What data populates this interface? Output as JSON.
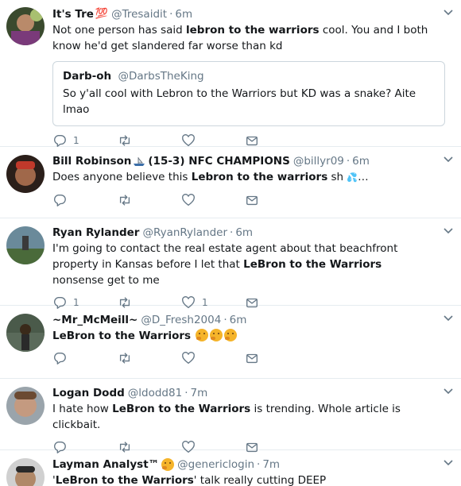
{
  "colors": {
    "accent": "#1da1f2",
    "muted": "#657786",
    "border": "#e6ecf0",
    "emoji": "#f5b42a"
  },
  "icons": {
    "reply": "reply-icon",
    "retweet": "retweet-icon",
    "like": "heart-icon",
    "dm": "envelope-icon",
    "menu": "chevron-down-icon"
  },
  "tweets": [
    {
      "name": "It's Tre",
      "badge": "💯",
      "handle": "@Tresaidit",
      "time": "6m",
      "text_parts": [
        "Not one person has said ",
        "lebron to the warriors",
        " cool. You and I both know he'd get slandered far worse than kd"
      ],
      "quote": {
        "name": "Darb-oh",
        "handle": "@DarbsTheKing",
        "text": "So y'all cool with Lebron to the Warriors but KD was a snake? Aite lmao"
      },
      "reply_count": "1",
      "like_count": ""
    },
    {
      "name": "Bill Robinson",
      "name_suffix": "(15-3) NFC CHAMPIONS",
      "handle": "@billyr09",
      "time": "6m",
      "text_parts": [
        "Does anyone believe this ",
        "Lebron to the warriors",
        " sh"
      ],
      "trail": "…",
      "reply_count": "",
      "like_count": ""
    },
    {
      "name": "Ryan Rylander",
      "handle": "@RyanRylander",
      "time": "6m",
      "text_parts": [
        "I'm going to contact the real estate agent about that beachfront property in Kansas before I let that ",
        "LeBron to the Warriors",
        " nonsense get to me"
      ],
      "reply_count": "1",
      "like_count": "1"
    },
    {
      "name": "~Mr_McMeill~",
      "handle": "@D_Fresh2004",
      "time": "6m",
      "text_parts": [
        "",
        "LeBron to the Warriors",
        ""
      ],
      "reply_count": "",
      "like_count": ""
    },
    {
      "name": "Logan Dodd",
      "handle": "@ldodd81",
      "time": "7m",
      "text_parts": [
        "I hate how ",
        "LeBron to the Warriors",
        " is trending. Whole article is clickbait."
      ],
      "reply_count": "",
      "like_count": ""
    },
    {
      "name": "Layman Analyst™",
      "handle": "@genericlogin",
      "time": "7m",
      "text_parts": [
        "'",
        "LeBron to the Warriors",
        "' talk really cutting DEEP"
      ],
      "reply_count": "",
      "like_count": ""
    }
  ]
}
